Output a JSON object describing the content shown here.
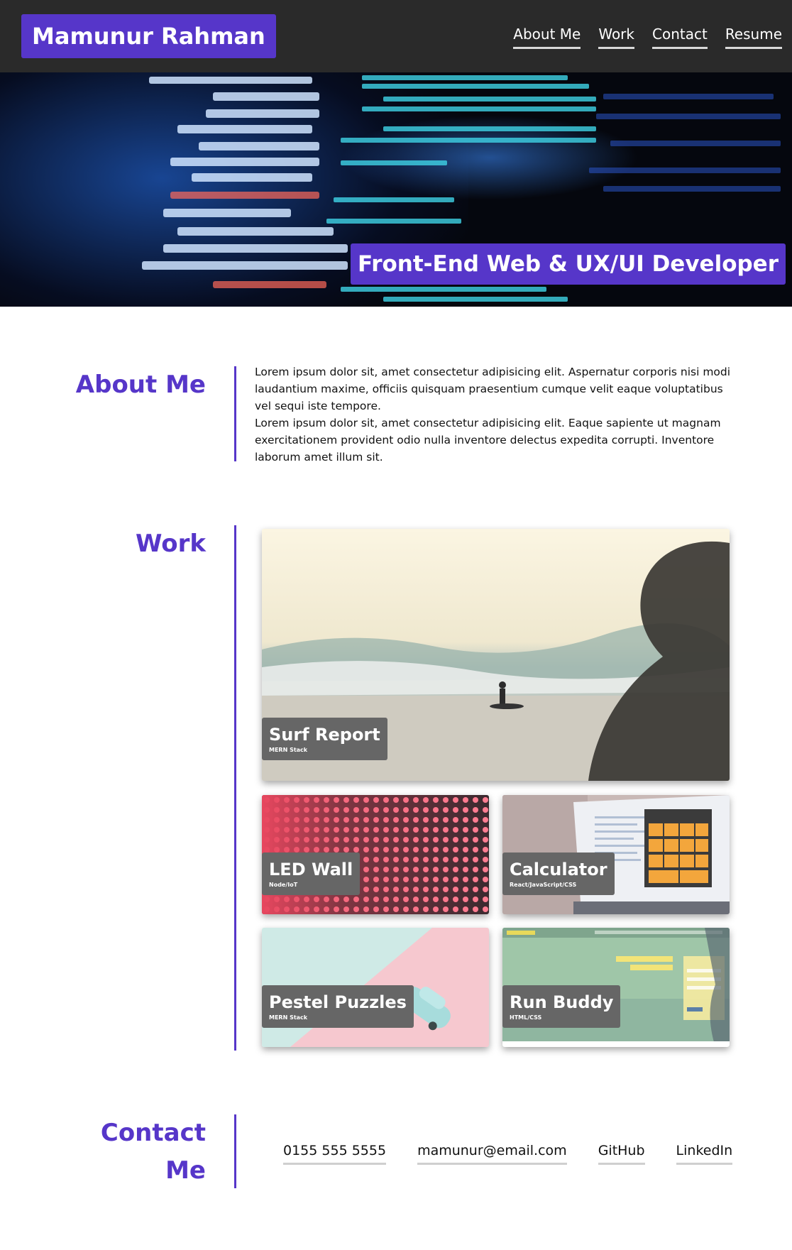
{
  "header": {
    "brand": "Mamunur Rahman",
    "nav": [
      "About Me",
      "Work",
      "Contact",
      "Resume"
    ]
  },
  "hero": {
    "title": "Front-End Web & UX/UI Developer"
  },
  "about": {
    "heading": "About Me",
    "paragraph_1": "Lorem ipsum dolor sit, amet consectetur adipisicing elit. Aspernatur corporis nisi modi laudantium maxime, officiis quisquam praesentium cumque velit eaque voluptatibus vel sequi iste tempore.",
    "paragraph_2": "Lorem ipsum dolor sit, amet consectetur adipisicing elit. Eaque sapiente ut magnam exercitationem provident odio nulla inventore delectus expedita corrupti. Inventore laborum amet illum sit."
  },
  "work": {
    "heading": "Work",
    "projects": [
      {
        "title": "Surf Report",
        "stack": "MERN Stack"
      },
      {
        "title": "LED Wall",
        "stack": "Node/IoT"
      },
      {
        "title": "Calculator",
        "stack": "React/JavaScript/CSS"
      },
      {
        "title": "Pestel Puzzles",
        "stack": "MERN Stack"
      },
      {
        "title": "Run Buddy",
        "stack": "HTML/CSS"
      }
    ]
  },
  "contact": {
    "heading_line_1": "Contact",
    "heading_line_2": "Me",
    "links": [
      "0155 555 5555",
      "mamunur@email.com",
      "GitHub",
      "LinkedIn"
    ]
  },
  "colors": {
    "accent": "#5636c9",
    "header_bg": "#2a2a2a",
    "label_bg": "#666666"
  },
  "icons": [
    "calculator-icon",
    "car-icon",
    "surfer-icon"
  ]
}
